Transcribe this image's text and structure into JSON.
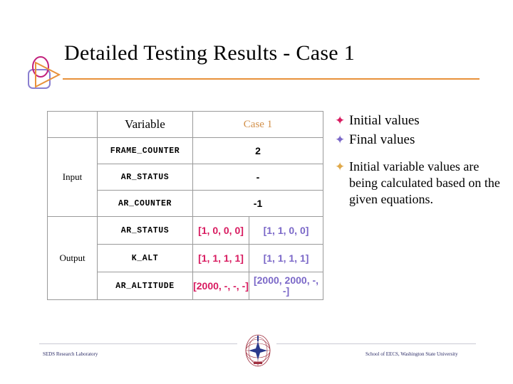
{
  "slide": {
    "title": "Detailed Testing Results - Case 1",
    "accent_color": "#E8913A",
    "initial_color": "#D81B60",
    "final_color": "#7B68C8",
    "case_header_color": "#D2904A"
  },
  "table": {
    "headers": {
      "corner": "",
      "variable": "Variable",
      "case": "Case 1"
    },
    "sections": [
      {
        "label": "Input",
        "rows": [
          {
            "variable": "FRAME_COUNTER",
            "span": true,
            "value": "2"
          },
          {
            "variable": "AR_STATUS",
            "span": true,
            "value": "-"
          },
          {
            "variable": "AR_COUNTER",
            "span": true,
            "value": "-1"
          }
        ]
      },
      {
        "label": "Output",
        "rows": [
          {
            "variable": "AR_STATUS",
            "span": false,
            "initial": "[1, 0, 0, 0]",
            "final": "[1, 1, 0, 0]"
          },
          {
            "variable": "K_ALT",
            "span": false,
            "initial": "[1, 1, 1, 1]",
            "final": "[1, 1, 1, 1]"
          },
          {
            "variable": "AR_ALTITUDE",
            "span": false,
            "initial": "[2000, -, -, -]",
            "final": "[2000, 2000, -, -]"
          }
        ]
      }
    ]
  },
  "legend": {
    "items": [
      {
        "marker": "diamond-cluster-icon",
        "color": "#D81B60",
        "text": "Initial values"
      },
      {
        "marker": "diamond-cluster-icon",
        "color": "#7B68C8",
        "text": "Final values"
      },
      {
        "marker": "diamond-cluster-icon",
        "color": "#E0A94A",
        "text": "Initial variable values are being calculated based on the given equations."
      }
    ]
  },
  "footer": {
    "left": "SEDS Research Laboratory",
    "right": "School of EECS, Washington State University",
    "emblem": "wsu-seal-icon"
  }
}
